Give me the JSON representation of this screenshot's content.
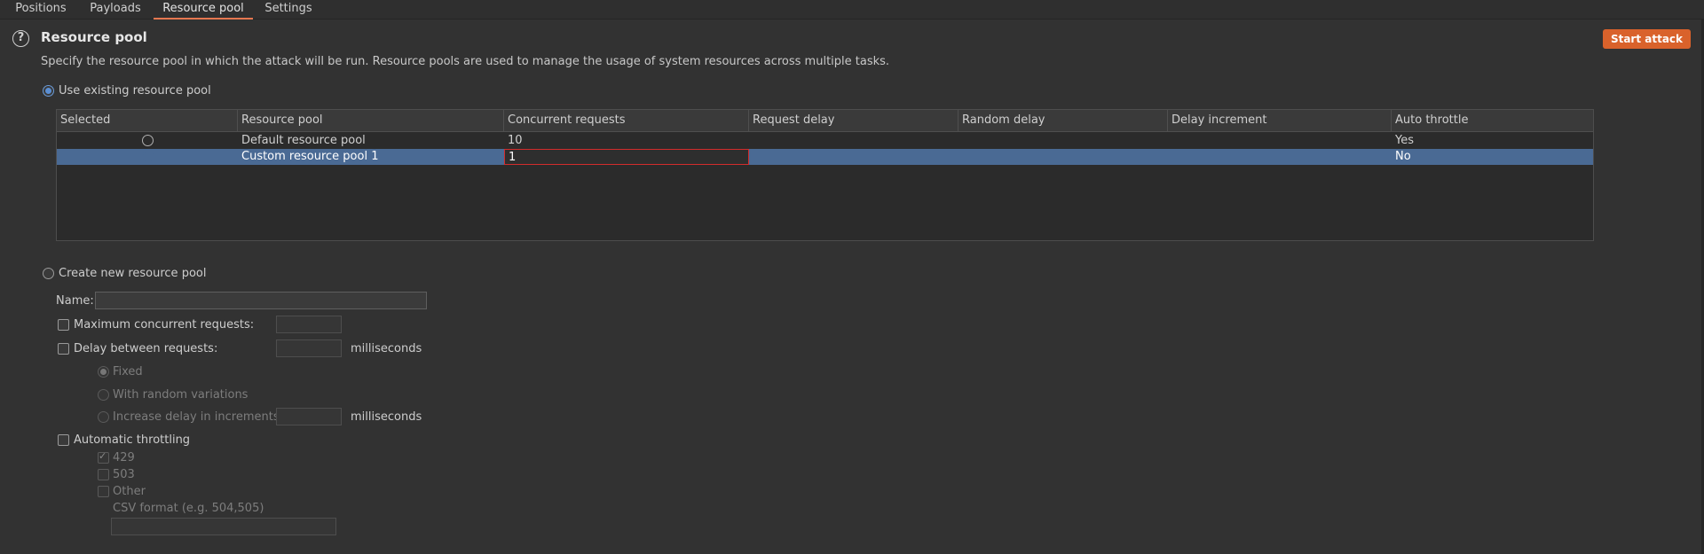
{
  "tabs": [
    "Positions",
    "Payloads",
    "Resource pool",
    "Settings"
  ],
  "header": {
    "title": "Resource pool",
    "description": "Specify the resource pool in which the attack will be run. Resource pools are used to manage the usage of system resources across multiple tasks.",
    "start_button": "Start attack"
  },
  "use_existing": {
    "label": "Use existing resource pool",
    "selected": true
  },
  "table": {
    "columns": [
      "Selected",
      "Resource pool",
      "Concurrent requests",
      "Request delay",
      "Random delay",
      "Delay increment",
      "Auto throttle"
    ],
    "rows": [
      {
        "pool": "Default resource pool",
        "concurrent": "10",
        "request_delay": "",
        "random_delay": "",
        "delay_increment": "",
        "auto_throttle": "Yes"
      },
      {
        "pool": "Custom resource pool 1",
        "concurrent": "1",
        "request_delay": "",
        "random_delay": "",
        "delay_increment": "",
        "auto_throttle": "No"
      }
    ]
  },
  "create_new": {
    "label": "Create new resource pool",
    "name_label": "Name:",
    "name_value": "",
    "max_concurrent_label": "Maximum concurrent requests:",
    "delay_label": "Delay between requests:",
    "milliseconds": "milliseconds",
    "fixed_label": "Fixed",
    "random_label": "With random variations",
    "increase_label": "Increase delay in increments of",
    "auto_throttling_label": "Automatic throttling",
    "code_429": "429",
    "code_503": "503",
    "other_label": "Other",
    "csv_label": "CSV format (e.g. 504,505)",
    "csv_value": ""
  },
  "colors": {
    "accent": "#d9622b",
    "selected_row": "#4a6a94",
    "edit_border": "#d22c2c",
    "background": "#323232"
  }
}
